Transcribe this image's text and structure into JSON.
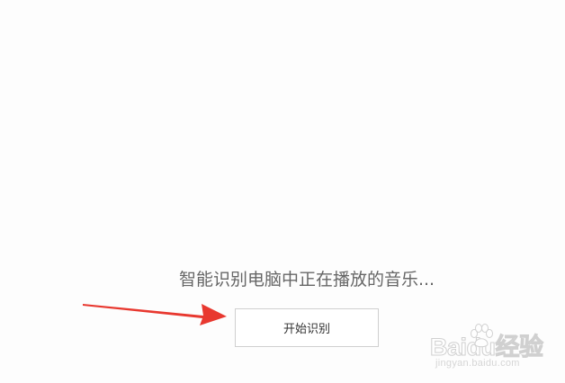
{
  "status": {
    "text": "智能识别电脑中正在播放的音乐..."
  },
  "actions": {
    "start_label": "开始识别"
  },
  "watermark": {
    "logo_text": "Baidu经验",
    "url_text": "jingyan.baidu.com"
  },
  "colors": {
    "background": "#fdfdfd",
    "status_text": "#666666",
    "button_border": "#cfcfcf",
    "arrow": "#e8382f"
  }
}
